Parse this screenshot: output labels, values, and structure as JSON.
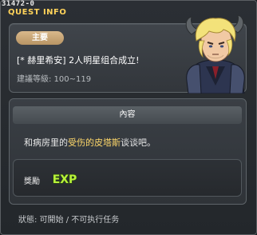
{
  "window": {
    "quest_id": "31472-0",
    "title": "QUEST INFO"
  },
  "info": {
    "tag": "主要",
    "quest_name": "[* 赫里希安] 2人明星组合成立!",
    "level_requirement": "建議等級: 100~119",
    "portrait": "horned-armored-warrior-portrait"
  },
  "content": {
    "header": "內容",
    "text_before": "和病房里的",
    "text_highlight": "受伤的皮塔斯",
    "text_after": "谈谈吧。"
  },
  "reward": {
    "label": "獎勵",
    "exp_label": "EXP",
    "exp_icon": "exp-icon"
  },
  "status": {
    "text": "狀態: 可開始 / 不可执行任务"
  },
  "colors": {
    "title": "#ffd35a",
    "highlight": "#ffd86a",
    "tag": "#c9a774",
    "exp": "#b8f23a"
  }
}
